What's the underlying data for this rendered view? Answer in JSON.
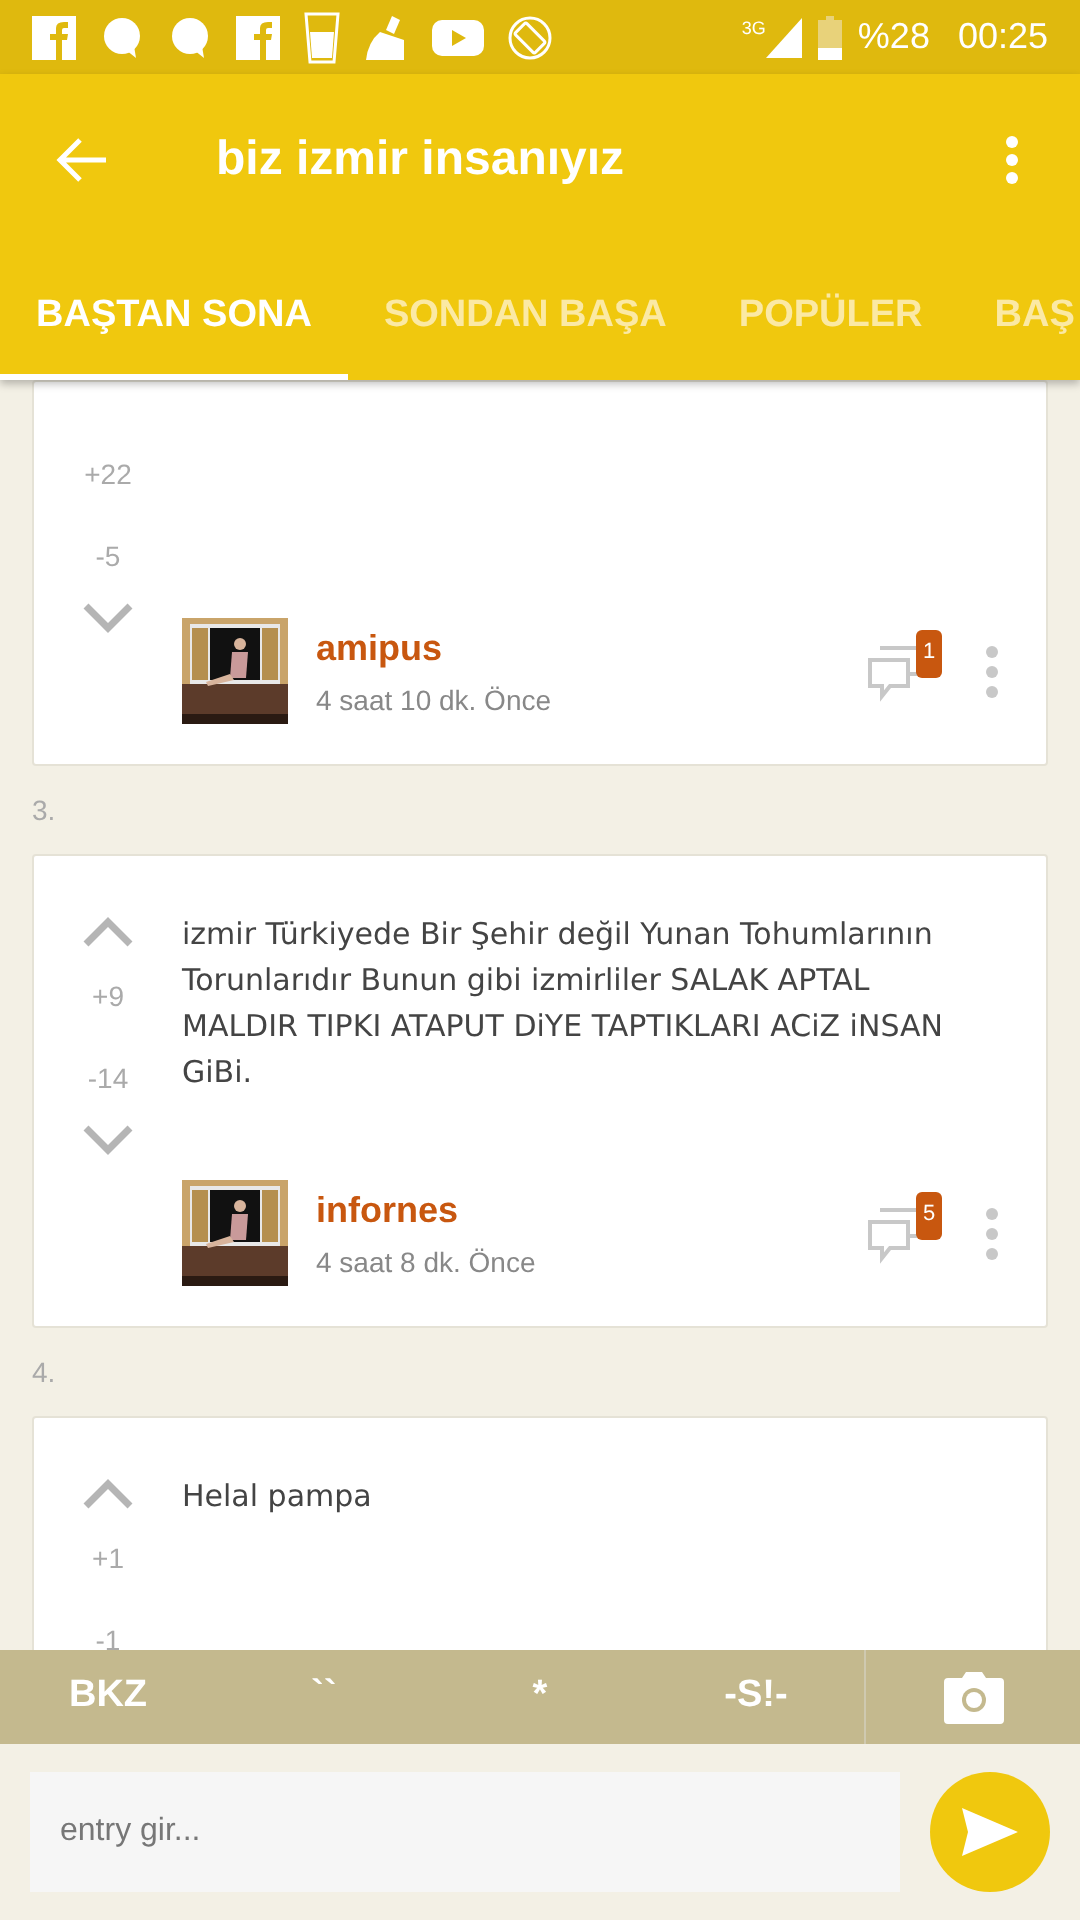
{
  "status_bar": {
    "network": "3G",
    "battery": "%28",
    "time": "00:25"
  },
  "app_bar": {
    "title": "biz izmir insanıyız"
  },
  "tabs": [
    {
      "label": "BAŞTAN SONA",
      "selected": true
    },
    {
      "label": "SONDAN BAŞA",
      "selected": false
    },
    {
      "label": "POPÜLER",
      "selected": false
    },
    {
      "label": "BAŞ",
      "selected": false
    }
  ],
  "entries": [
    {
      "up": "+22",
      "down": "-5",
      "author": "amipus",
      "time": "4 saat 10 dk. Önce",
      "comments": "1"
    },
    {
      "number": "3.",
      "text": "izmir Türkiyede Bir Şehir değil Yunan Tohumlarının Torunlarıdır Bunun gibi izmirliler SALAK APTAL MALDIR TIPKI ATAPUT DiYE TAPTIKLARI ACiZ iNSAN GiBi.",
      "up": "+9",
      "down": "-14",
      "author": "infornes",
      "time": "4 saat 8 dk. Önce",
      "comments": "5"
    },
    {
      "number": "4.",
      "text": "Helal pampa",
      "up": "+1",
      "down": "-1"
    }
  ],
  "toolbar": [
    "BKZ",
    "``",
    "*",
    "-S!-"
  ],
  "entry_input": {
    "placeholder": "entry gir..."
  }
}
